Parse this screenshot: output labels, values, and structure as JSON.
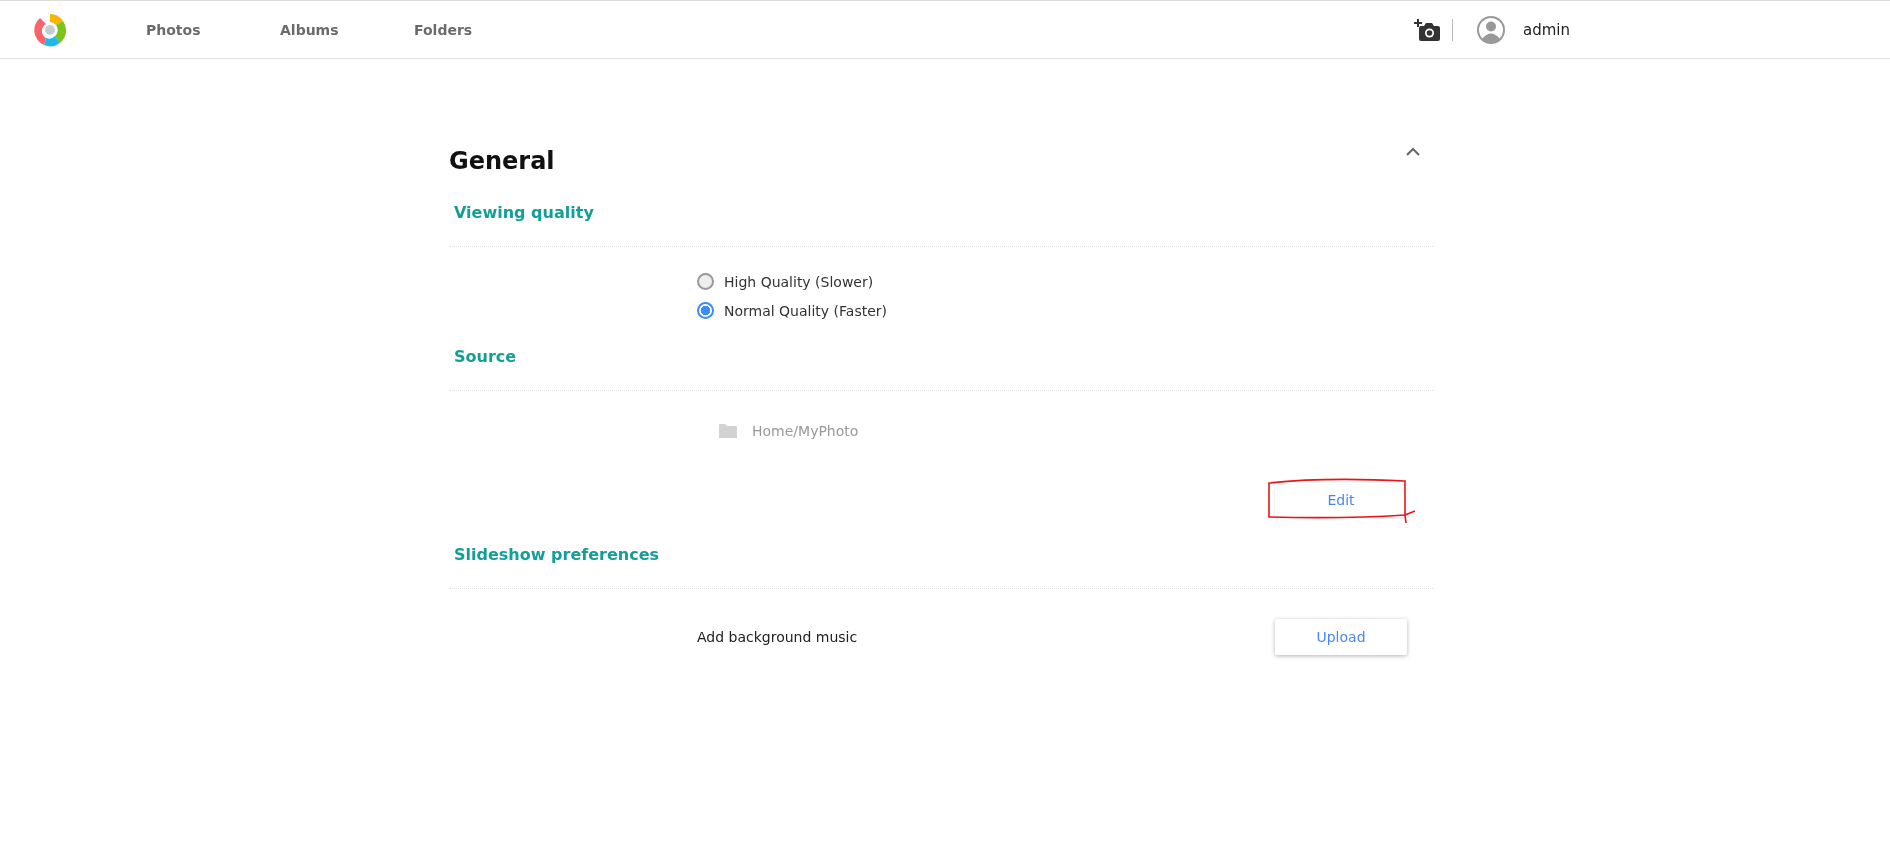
{
  "header": {
    "nav": [
      {
        "label": "Photos",
        "selected": false
      },
      {
        "label": "Albums",
        "selected": false
      },
      {
        "label": "Folders",
        "selected": false
      }
    ],
    "user": {
      "name": "admin"
    }
  },
  "panel": {
    "title": "General",
    "expanded": true,
    "sections": [
      {
        "kind": "radio",
        "heading": "Viewing quality",
        "options": [
          {
            "label": "High Quality (Slower)",
            "selected": false
          },
          {
            "label": "Normal Quality (Faster)",
            "selected": true
          }
        ]
      },
      {
        "kind": "source",
        "heading": "Source",
        "path": "Home/MyPhoto",
        "button": "Edit",
        "annotated": true
      },
      {
        "kind": "action",
        "heading": "Slideshow preferences",
        "label": "Add background music",
        "button": "Upload"
      }
    ]
  }
}
